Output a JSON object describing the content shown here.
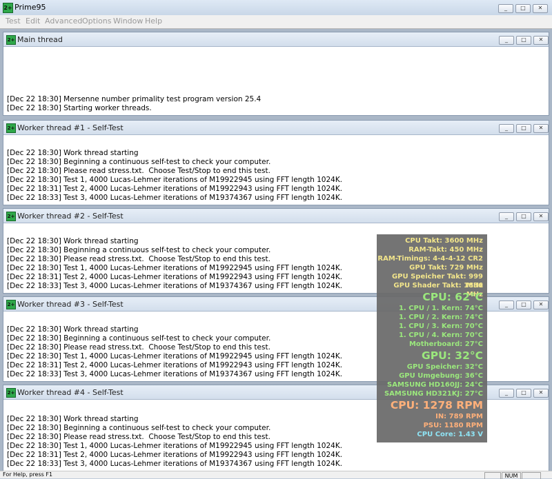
{
  "app": {
    "title": "Prime95",
    "icon": "prime95-icon",
    "icon_text": "2+"
  },
  "window_buttons": [
    "_",
    "□",
    "✕"
  ],
  "menu": [
    "Test",
    "Edit",
    "Advanced",
    "Options",
    "Window",
    "Help"
  ],
  "windows": [
    {
      "title": "Main thread",
      "lines": [
        "[Dec 22 18:30] Mersenne number primality test program version 25.4",
        "[Dec 22 18:30] Starting worker threads."
      ]
    },
    {
      "title": "Worker thread #1 - Self-Test",
      "lines": [
        "[Dec 22 18:30] Work thread starting",
        "[Dec 22 18:30] Beginning a continuous self-test to check your computer.",
        "[Dec 22 18:30] Please read stress.txt.  Choose Test/Stop to end this test.",
        "[Dec 22 18:30] Test 1, 4000 Lucas-Lehmer iterations of M19922945 using FFT length 1024K.",
        "[Dec 22 18:31] Test 2, 4000 Lucas-Lehmer iterations of M19922943 using FFT length 1024K.",
        "[Dec 22 18:33] Test 3, 4000 Lucas-Lehmer iterations of M19374367 using FFT length 1024K."
      ]
    },
    {
      "title": "Worker thread #2 - Self-Test",
      "lines": [
        "[Dec 22 18:30] Work thread starting",
        "[Dec 22 18:30] Beginning a continuous self-test to check your computer.",
        "[Dec 22 18:30] Please read stress.txt.  Choose Test/Stop to end this test.",
        "[Dec 22 18:30] Test 1, 4000 Lucas-Lehmer iterations of M19922945 using FFT length 1024K.",
        "[Dec 22 18:31] Test 2, 4000 Lucas-Lehmer iterations of M19922943 using FFT length 1024K.",
        "[Dec 22 18:33] Test 3, 4000 Lucas-Lehmer iterations of M19374367 using FFT length 1024K."
      ]
    },
    {
      "title": "Worker thread #3 - Self-Test",
      "lines": [
        "[Dec 22 18:30] Work thread starting",
        "[Dec 22 18:30] Beginning a continuous self-test to check your computer.",
        "[Dec 22 18:30] Please read stress.txt.  Choose Test/Stop to end this test.",
        "[Dec 22 18:30] Test 1, 4000 Lucas-Lehmer iterations of M19922945 using FFT length 1024K.",
        "[Dec 22 18:31] Test 2, 4000 Lucas-Lehmer iterations of M19922943 using FFT length 1024K.",
        "[Dec 22 18:33] Test 3, 4000 Lucas-Lehmer iterations of M19374367 using FFT length 1024K."
      ]
    },
    {
      "title": "Worker thread #4 - Self-Test",
      "lines": [
        "[Dec 22 18:30] Work thread starting",
        "[Dec 22 18:30] Beginning a continuous self-test to check your computer.",
        "[Dec 22 18:30] Please read stress.txt.  Choose Test/Stop to end this test.",
        "[Dec 22 18:30] Test 1, 4000 Lucas-Lehmer iterations of M19922945 using FFT length 1024K.",
        "[Dec 22 18:31] Test 2, 4000 Lucas-Lehmer iterations of M19922943 using FFT length 1024K.",
        "[Dec 22 18:33] Test 3, 4000 Lucas-Lehmer iterations of M19374367 using FFT length 1024K."
      ]
    }
  ],
  "status": {
    "text": "For Help, press F1",
    "num": "NUM"
  },
  "overlay": {
    "lines": [
      {
        "text": "CPU Takt: 3600 MHz",
        "color": "yellow",
        "big": false
      },
      {
        "text": "RAM-Takt: 450 MHz",
        "color": "yellow",
        "big": false
      },
      {
        "text": "RAM-Timings: 4-4-4-12 CR2",
        "color": "yellow",
        "big": false
      },
      {
        "text": "GPU Takt: 729 MHz",
        "color": "yellow",
        "big": false
      },
      {
        "text": "GPU Speicher Takt: 999 MHz",
        "color": "yellow",
        "big": false
      },
      {
        "text": "GPU Shader Takt: 1836 MHz",
        "color": "yellow",
        "big": false
      },
      {
        "text": "CPU: 62°C",
        "color": "green",
        "big": true
      },
      {
        "text": "1. CPU / 1. Kern: 74°C",
        "color": "green",
        "big": false
      },
      {
        "text": "1. CPU / 2. Kern: 74°C",
        "color": "green",
        "big": false
      },
      {
        "text": "1. CPU / 3. Kern: 70°C",
        "color": "green",
        "big": false
      },
      {
        "text": "1. CPU / 4. Kern: 70°C",
        "color": "green",
        "big": false
      },
      {
        "text": "Motherboard: 27°C",
        "color": "green",
        "big": false
      },
      {
        "text": "GPU: 32°C",
        "color": "green",
        "big": true
      },
      {
        "text": "GPU Speicher: 32°C",
        "color": "green",
        "big": false
      },
      {
        "text": "GPU Umgebung: 36°C",
        "color": "green",
        "big": false
      },
      {
        "text": "SAMSUNG HD160JJ: 24°C",
        "color": "green",
        "big": false
      },
      {
        "text": "SAMSUNG HD321KJ: 27°C",
        "color": "green",
        "big": false
      },
      {
        "text": "CPU: 1278 RPM",
        "color": "orange",
        "big": true
      },
      {
        "text": "IN: 789 RPM",
        "color": "orange",
        "big": false
      },
      {
        "text": "PSU: 1180 RPM",
        "color": "orange",
        "big": false
      },
      {
        "text": "CPU Core: 1.43 V",
        "color": "cyan",
        "big": false
      }
    ]
  }
}
